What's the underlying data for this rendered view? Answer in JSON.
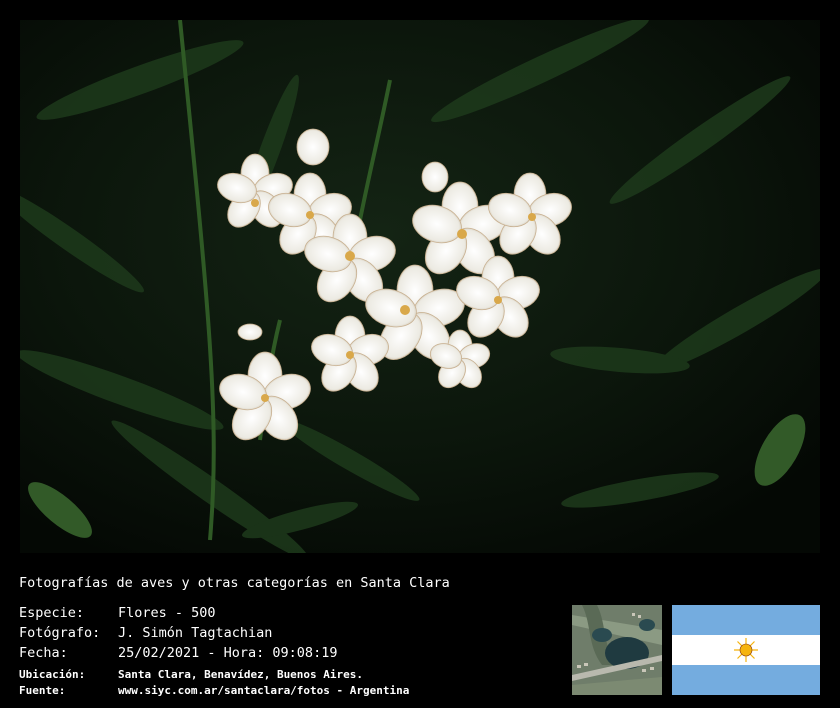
{
  "header": {
    "title": "Fotografías de aves y otras categorías en Santa Clara"
  },
  "info": {
    "species_label": "Especie:",
    "species_value": "Flores - 500",
    "photographer_label": "Fotógrafo:",
    "photographer_value": "J. Simón Tagtachian",
    "date_label": "Fecha:",
    "date_value": "25/02/2021 - Hora: 09:08:19",
    "location_label": "Ubicación:",
    "location_value": "Santa Clara, Benavídez, Buenos Aires.",
    "source_label": "Fuente:",
    "source_value": "www.siyc.com.ar/santaclara/fotos - Argentina"
  },
  "colors": {
    "flag_blue": "#74acdf",
    "flag_white": "#ffffff",
    "sun": "#f6b40e"
  },
  "icons": {
    "map": "satellite-map-thumbnail",
    "flag": "argentina-flag"
  }
}
